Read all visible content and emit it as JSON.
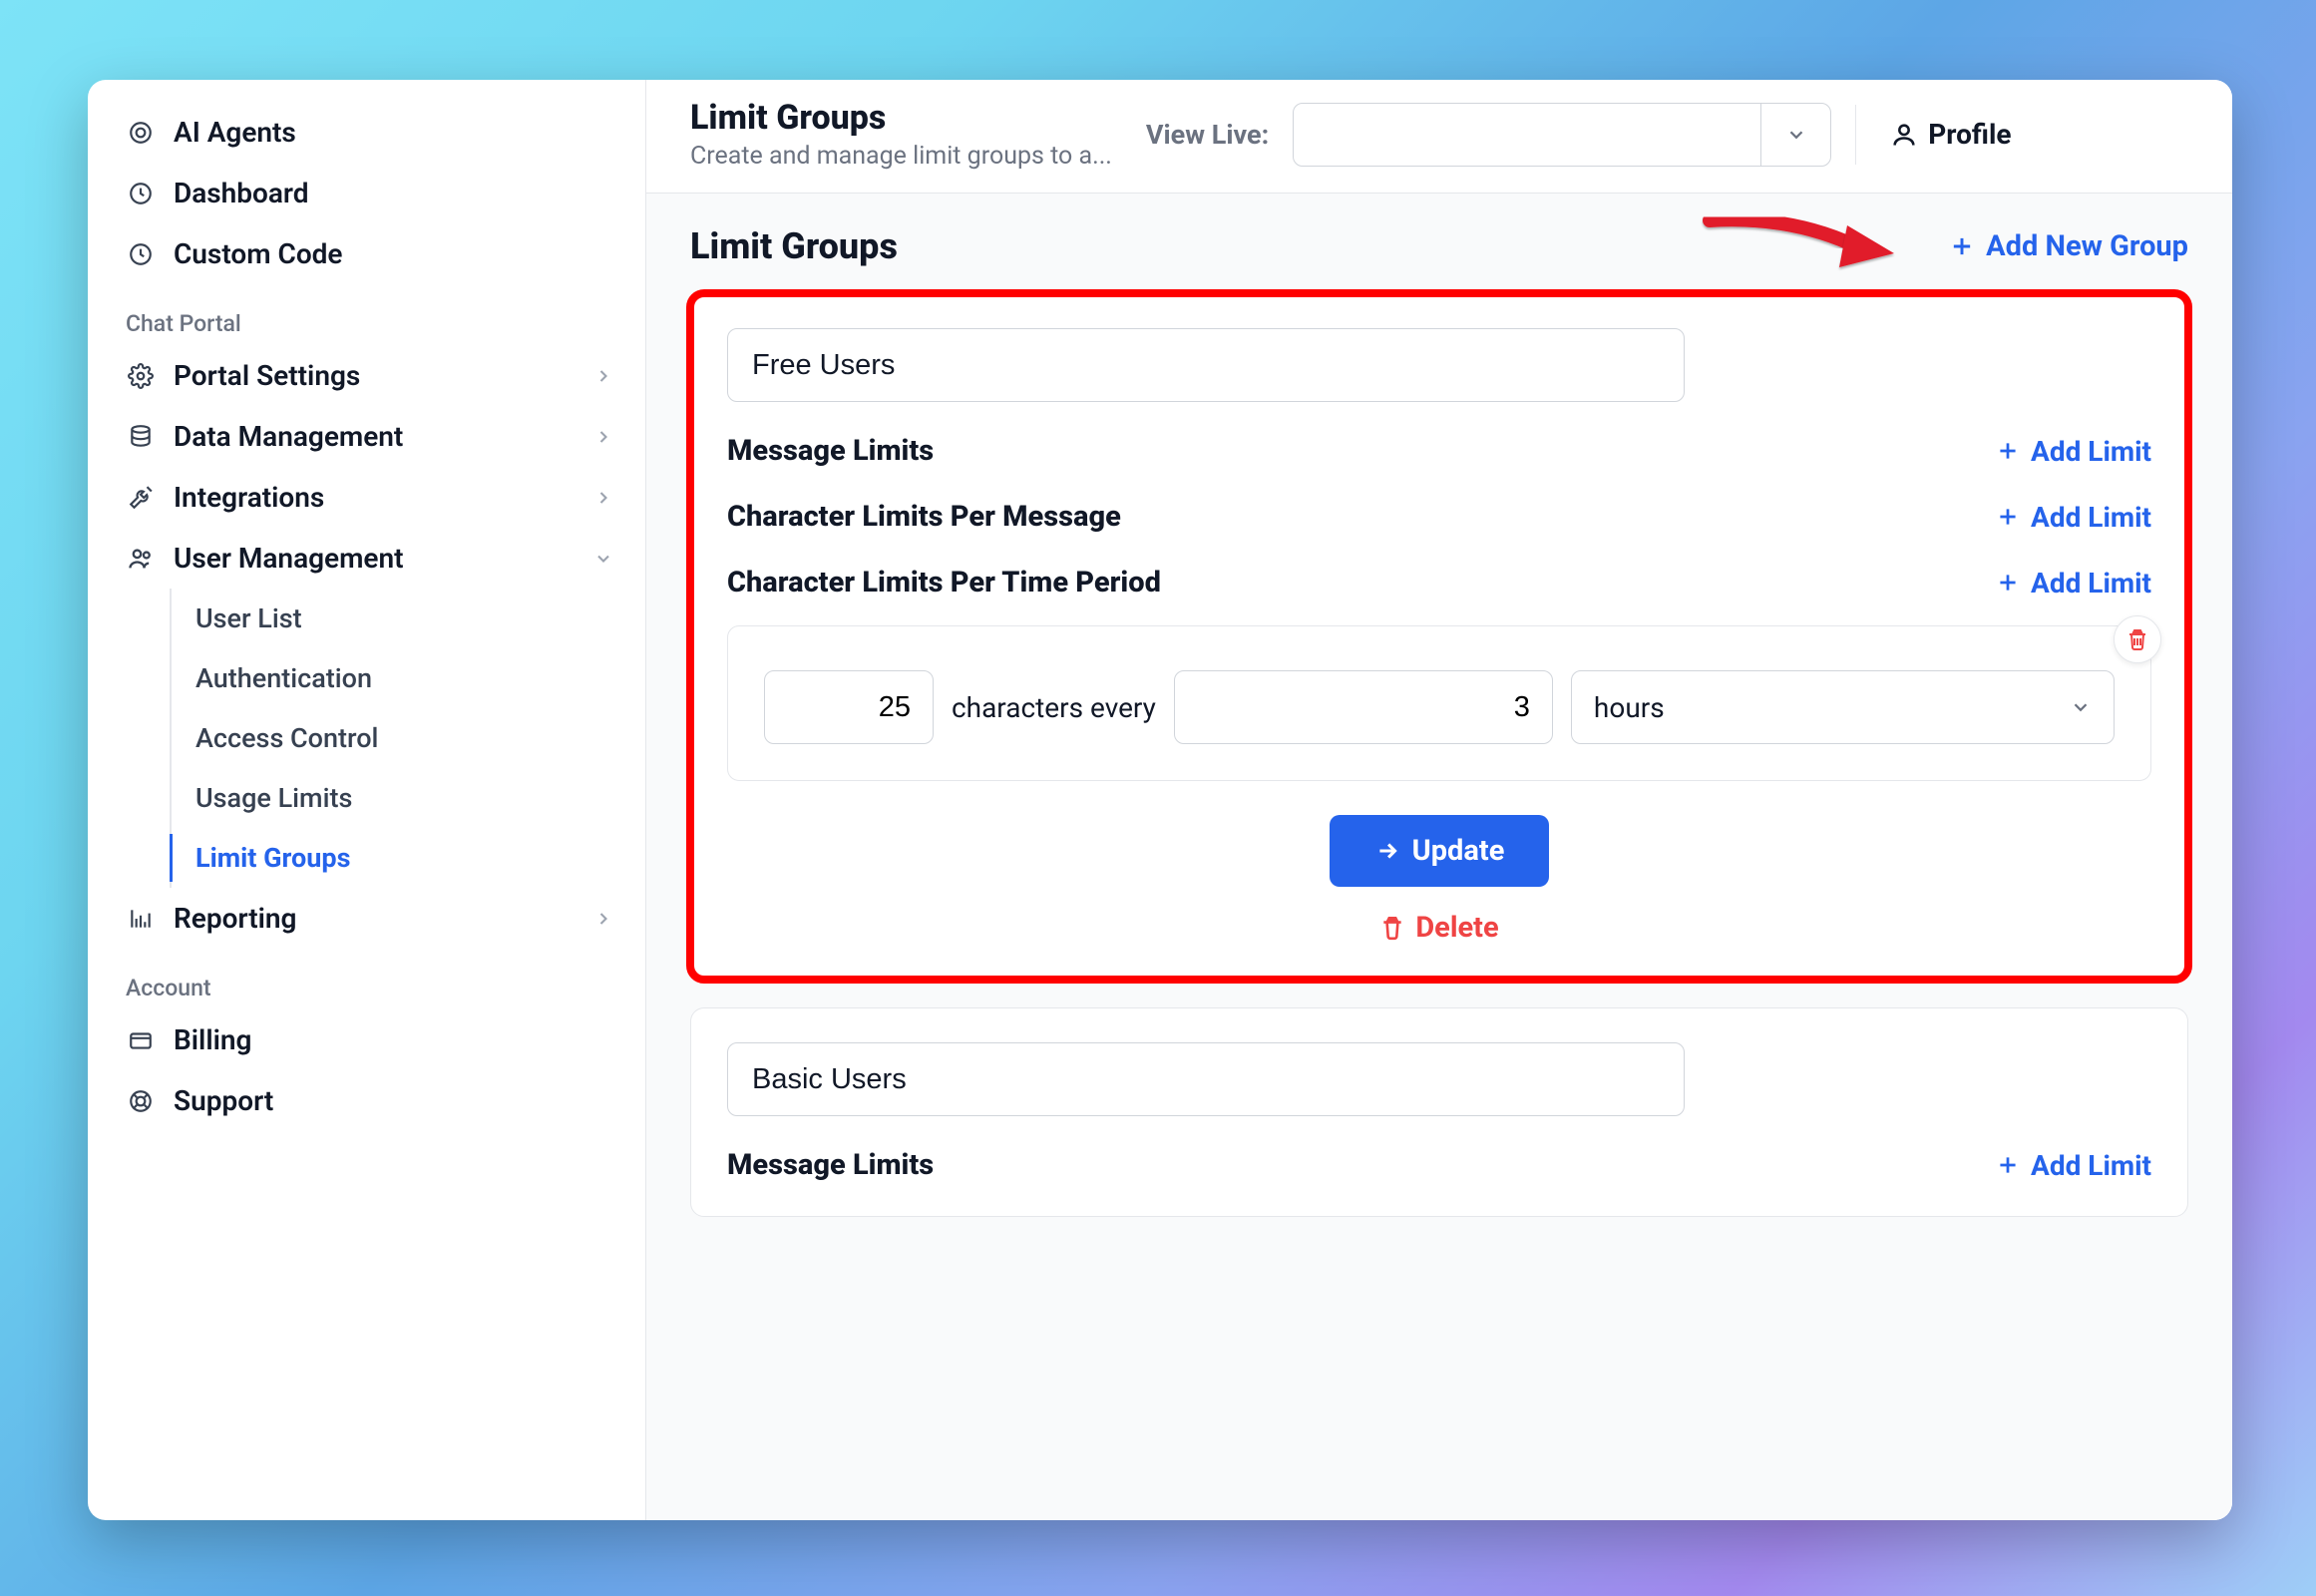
{
  "sidebar": {
    "top_items": [
      {
        "label": "AI Agents",
        "icon": "target-icon"
      },
      {
        "label": "Dashboard",
        "icon": "clock-icon"
      },
      {
        "label": "Custom Code",
        "icon": "clock-icon"
      }
    ],
    "section1_label": "Chat Portal",
    "section1_items": [
      {
        "label": "Portal Settings",
        "icon": "gear-icon",
        "expandable": true
      },
      {
        "label": "Data Management",
        "icon": "database-icon",
        "expandable": true
      },
      {
        "label": "Integrations",
        "icon": "tools-icon",
        "expandable": true
      },
      {
        "label": "User Management",
        "icon": "users-icon",
        "expandable": true,
        "expanded": true
      }
    ],
    "user_mgmt_sub": [
      {
        "label": "User List"
      },
      {
        "label": "Authentication"
      },
      {
        "label": "Access Control"
      },
      {
        "label": "Usage Limits"
      },
      {
        "label": "Limit Groups",
        "active": true
      }
    ],
    "reporting": {
      "label": "Reporting",
      "icon": "chart-icon",
      "expandable": true
    },
    "section2_label": "Account",
    "section2_items": [
      {
        "label": "Billing",
        "icon": "card-icon"
      },
      {
        "label": "Support",
        "icon": "life-ring-icon"
      }
    ]
  },
  "topbar": {
    "title": "Limit Groups",
    "subtitle": "Create and manage limit groups to a...",
    "view_live_label": "View Live:",
    "profile_label": "Profile"
  },
  "content": {
    "heading": "Limit Groups",
    "add_group_label": "Add New Group",
    "add_limit_label": "Add Limit",
    "groups": [
      {
        "name": "Free Users",
        "highlighted": true,
        "sections": {
          "message_limits": "Message Limits",
          "char_per_msg": "Character Limits Per Message",
          "char_per_time": "Character Limits Per Time Period"
        },
        "time_limit_row": {
          "char_count": "25",
          "static": "characters every",
          "period_count": "3",
          "unit": "hours"
        },
        "update_label": "Update",
        "delete_label": "Delete"
      },
      {
        "name": "Basic Users",
        "sections": {
          "message_limits": "Message Limits"
        }
      }
    ]
  }
}
